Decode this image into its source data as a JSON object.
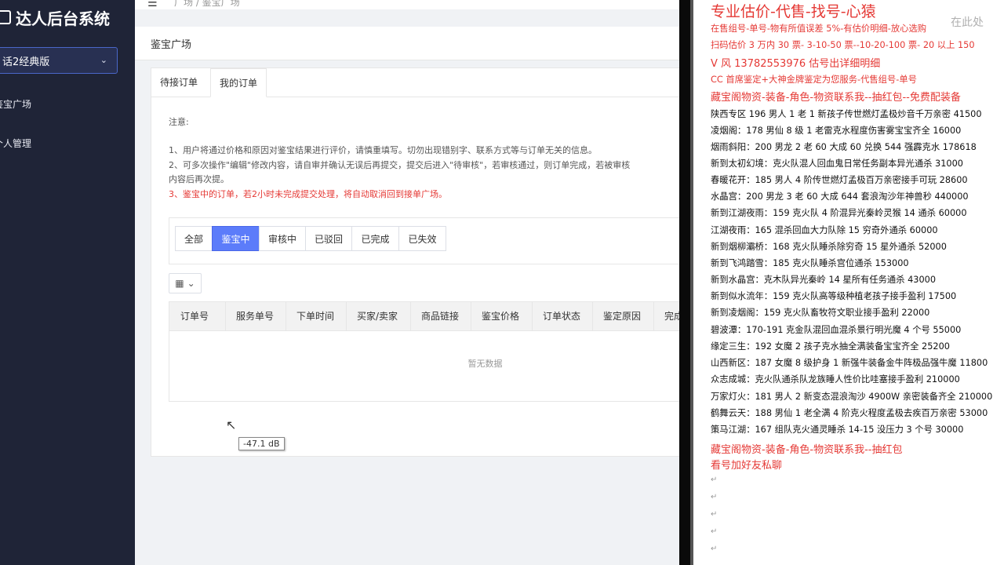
{
  "sidebar": {
    "logo": "达人后台系统",
    "game_select": "话2经典版",
    "items": [
      "鉴宝广场",
      "个人管理"
    ]
  },
  "header": {
    "breadcrumb": "广场  /  鉴宝广场"
  },
  "page": {
    "title": "鉴宝广场",
    "tabs": [
      "待接订单",
      "我的订单"
    ],
    "notice_title": "注意:",
    "notices": [
      "1、用户将通过价格和原因对鉴宝结果进行评价，请慎重填写。切勿出现错别字、联系方式等与订单无关的信息。",
      "2、可多次操作\"编辑\"修改内容，请自审并确认无误后再提交，提交后进入\"待审核\"，若审核通过，则订单完成，若被审核",
      "内容后再次提。",
      "3、鉴宝中的订单，若2小时未完成提交处理，将自动取消回到接单广场。"
    ],
    "filters": [
      "全部",
      "鉴宝中",
      "审核中",
      "已驳回",
      "已完成",
      "已失效"
    ],
    "active_filter": "鉴宝中",
    "columns": [
      "订单号",
      "服务单号",
      "下单时间",
      "买家/卖家",
      "商品链接",
      "鉴宝价格",
      "订单状态",
      "鉴定原因",
      "完成"
    ],
    "empty_text": "暂无数据",
    "tooltip": "-47.1 dB"
  },
  "document": {
    "watermark": "在此处",
    "lines": [
      {
        "text": "专业估价-代售-找号-心猿",
        "style": "red big"
      },
      {
        "text": "在售组号-单号-物有所值误差 5%-有估价明细-放心选购",
        "style": "red"
      },
      {
        "text": "扫码估价 3 万内 30 票- 3-10-50 票--10-20-100 票- 20 以上 150",
        "style": "red"
      },
      {
        "text": "V  风    13782553976   估号出详细明细",
        "style": "red mid"
      },
      {
        "text": "CC 首席鉴定+大神金牌鉴定为您服务-代售组号-单号",
        "style": "red"
      },
      {
        "text": "藏宝阁物资-装备-角色-物资联系我--抽红包--免费配装备",
        "style": "red mid"
      },
      {
        "text": "陕西专区 196 男人 1 老 1 新孩子传世燃灯孟极炒音千万亲密 41500",
        "style": ""
      },
      {
        "text": "凌烟阁：178 男仙 8 级 1 老雷克水程度伤害雾宝宝齐全 16000",
        "style": ""
      },
      {
        "text": "烟雨斜阳：200 男龙 2 老 60 大成 60 兑换 544 强霹克水 178618",
        "style": ""
      },
      {
        "text": "新到太初幻境：克火队混人回血鬼日常任务副本异光通杀 31000",
        "style": ""
      },
      {
        "text": "春暖花开：185 男人 4 阶传世燃灯孟极百万亲密接手可玩 28600",
        "style": ""
      },
      {
        "text": "水晶宫：200 男龙 3 老 60 大成 644 套浪淘沙年神兽秒 440000",
        "style": ""
      },
      {
        "text": "新到江湖夜雨：159 克火队 4 阶混异光秦岭灵猴 14 通杀 60000",
        "style": ""
      },
      {
        "text": "江湖夜雨：165 混杀回血大力队除 15 穷奇外通杀 60000",
        "style": ""
      },
      {
        "text": "新到烟柳灞桥：168 克火队睡杀除穷奇 15 星外通杀 52000",
        "style": ""
      },
      {
        "text": "新到飞鸿踏雪：185 克火队睡杀宫位通杀 153000",
        "style": ""
      },
      {
        "text": "新到水晶宫：克木队异光秦岭 14 星所有任务通杀 43000",
        "style": ""
      },
      {
        "text": "新到似水流年：159 克火队高等级种植老孩子接手盈利 17500",
        "style": ""
      },
      {
        "text": "新到凌烟阁：159 克火队畜牧符文职业接手盈利 22000",
        "style": ""
      },
      {
        "text": "碧波潭：170-191 克金队混回血混杀景行明光魔 4 个号 55000",
        "style": ""
      },
      {
        "text": "缘定三生：192 女魔 2 孩子克水抽全满装备宝宝齐全 25200",
        "style": ""
      },
      {
        "text": "山西新区：187 女魔 8 级护身 1 新强牛装备金牛阵极品强牛魔 11800",
        "style": ""
      },
      {
        "text": "众志成城：克火队通杀队龙族睡人性价比哇塞接手盈利 210000",
        "style": ""
      },
      {
        "text": "万家灯火：181 男人 2 新变态混浪淘沙 4900W 亲密装备齐全 210000",
        "style": ""
      },
      {
        "text": "鹤舞云天：188 男仙 1 老全满 4 阶克火程度孟极去疾百万亲密 53000",
        "style": ""
      },
      {
        "text": "策马江湖：167 组队克火通灵睡杀 14-15 没压力 3 个号 30000",
        "style": ""
      },
      {
        "text": "藏宝阁物资-装备-角色-物资联系我--抽红包",
        "style": "red mid"
      },
      {
        "text": "看号加好友私聊",
        "style": "red mid"
      }
    ]
  }
}
